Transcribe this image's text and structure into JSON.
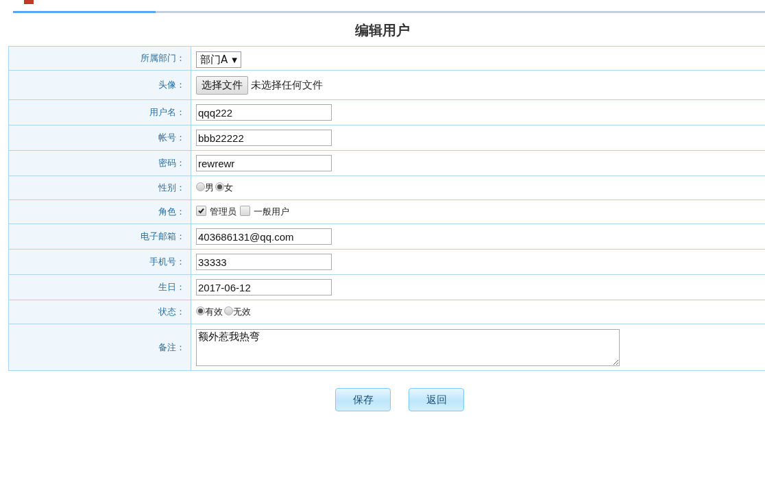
{
  "title": "编辑用户",
  "fields": [
    {
      "kind": "select",
      "label": "所属部门：",
      "value": "部门A",
      "caret": "▼"
    },
    {
      "kind": "file",
      "label": "头像：",
      "button": "选择文件",
      "status": "未选择任何文件"
    },
    {
      "kind": "text",
      "label": "用户名：",
      "value": "qqq222"
    },
    {
      "kind": "text",
      "label": "帐号：",
      "value": "bbb22222"
    },
    {
      "kind": "text",
      "label": "密码：",
      "value": "rewrewr"
    },
    {
      "kind": "radio",
      "label": "性别：",
      "options": [
        {
          "label": "男",
          "selected": false
        },
        {
          "label": "女",
          "selected": true
        }
      ]
    },
    {
      "kind": "checkbox",
      "label": "角色：",
      "options": [
        {
          "label": "管理员",
          "checked": true
        },
        {
          "label": "一般用户",
          "checked": false
        }
      ]
    },
    {
      "kind": "text",
      "label": "电子邮箱：",
      "value": "403686131@qq.com"
    },
    {
      "kind": "text",
      "label": "手机号：",
      "value": "33333"
    },
    {
      "kind": "text",
      "label": "生日：",
      "value": "2017-06-12"
    },
    {
      "kind": "radio",
      "label": "状态：",
      "options": [
        {
          "label": "有效",
          "selected": true
        },
        {
          "label": "无效",
          "selected": false
        }
      ]
    },
    {
      "kind": "textarea",
      "label": "备注：",
      "value": "额外惹我热弯"
    }
  ],
  "buttons": [
    "保存",
    "返回"
  ]
}
